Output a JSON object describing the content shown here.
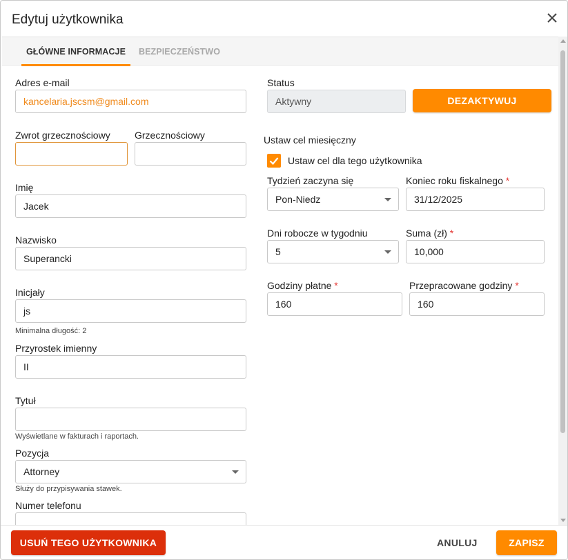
{
  "dialog": {
    "title": "Edytuj użytkownika"
  },
  "tabs": [
    {
      "label": "GŁÓWNE INFORMACJE",
      "active": true
    },
    {
      "label": "BEZPIECZEŃSTWO",
      "active": false
    }
  ],
  "left": {
    "email": {
      "label": "Adres e-mail",
      "value": "kancelaria.jscsm@gmail.com"
    },
    "salutation": {
      "label": "Zwrot grzecznościowy",
      "value": ""
    },
    "courtesy": {
      "label": "Grzecznościowy",
      "value": ""
    },
    "first_name": {
      "label": "Imię",
      "value": "Jacek"
    },
    "last_name": {
      "label": "Nazwisko",
      "value": "Superancki"
    },
    "initials": {
      "label": "Inicjały",
      "value": "js",
      "hint": "Minimalna długość: 2"
    },
    "suffix": {
      "label": "Przyrostek imienny",
      "value": "II"
    },
    "job_title": {
      "label": "Tytuł",
      "value": "",
      "hint": "Wyświetlane w fakturach i raportach."
    },
    "position": {
      "label": "Pozycja",
      "value": "Attorney",
      "hint": "Służy do przypisywania stawek."
    },
    "phone": {
      "label": "Numer telefonu",
      "value": ""
    }
  },
  "right": {
    "status": {
      "label": "Status",
      "value": "Aktywny",
      "deactivate_label": "DEZAKTYWUJ"
    },
    "monthly_goal": {
      "section_title": "Ustaw cel miesięczny",
      "checkbox_label": "Ustaw cel dla tego użytkownika",
      "checked": true,
      "week_starts": {
        "label": "Tydzień zaczyna się",
        "value": "Pon-Niedz"
      },
      "fiscal_year_end": {
        "label": "Koniec roku fiskalnego",
        "value": "31/12/2025",
        "required_mark": "*"
      },
      "workdays": {
        "label": "Dni robocze w tygodniu",
        "value": "5"
      },
      "amount": {
        "label": "Suma (zł)",
        "value": "10,000",
        "required_mark": "*"
      },
      "billable_hours": {
        "label": "Godziny płatne",
        "value": "160",
        "required_mark": "*"
      },
      "worked_hours": {
        "label": "Przepracowane godziny",
        "value": "160",
        "required_mark": "*"
      }
    }
  },
  "footer": {
    "delete_label": "USUŃ TEGO UŻYTKOWNIKA",
    "cancel_label": "ANULUJ",
    "save_label": "ZAPISZ"
  },
  "colors": {
    "accent": "#ff8a00",
    "danger": "#dc2f0a",
    "required": "#e53935"
  }
}
